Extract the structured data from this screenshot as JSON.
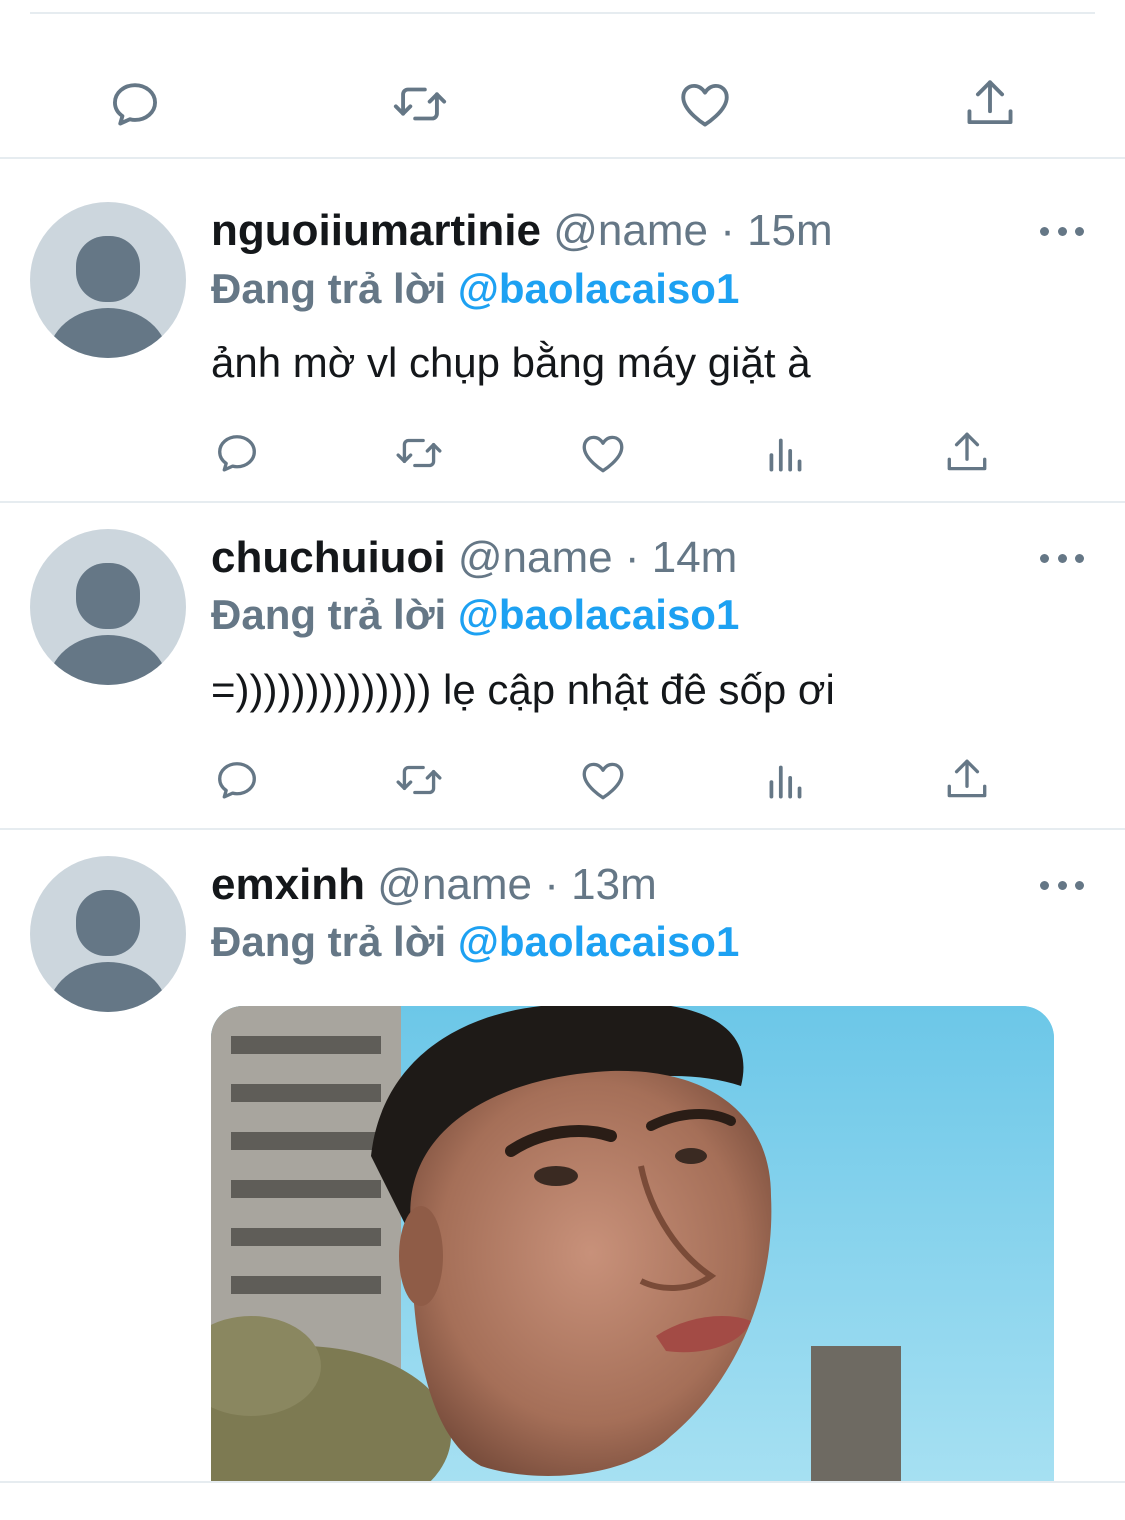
{
  "icons": {
    "reply": "reply-icon",
    "retweet": "retweet-icon",
    "like": "heart-icon",
    "share": "share-icon",
    "analytics": "analytics-icon",
    "more": "more-icon",
    "avatar": "default-avatar-icon"
  },
  "colors": {
    "text": "#14171a",
    "muted": "#657786",
    "accent": "#1da1f2",
    "divider": "#e6ecf0",
    "avatar_bg": "#ccd6dd",
    "avatar_fg": "#657786"
  },
  "replies": [
    {
      "username": "nguoiiumartinie",
      "handle": "@name",
      "sep": " · ",
      "time": "15m",
      "replying_label": "Đang trả lời ",
      "replying_to": "@baolacaiso1",
      "text": "ảnh mờ vl chụp bằng máy giặt à"
    },
    {
      "username": "chuchuiuoi",
      "handle": "@name",
      "sep": " · ",
      "time": "14m",
      "replying_label": "Đang trả lời ",
      "replying_to": "@baolacaiso1",
      "text": "=)))))))))))))) lẹ cập nhật đê sốp ơi"
    },
    {
      "username": "emxinh",
      "handle": "@name",
      "sep": " · ",
      "time": "13m",
      "replying_label": "Đang trả lời ",
      "replying_to": "@baolacaiso1",
      "media": "photo"
    }
  ]
}
